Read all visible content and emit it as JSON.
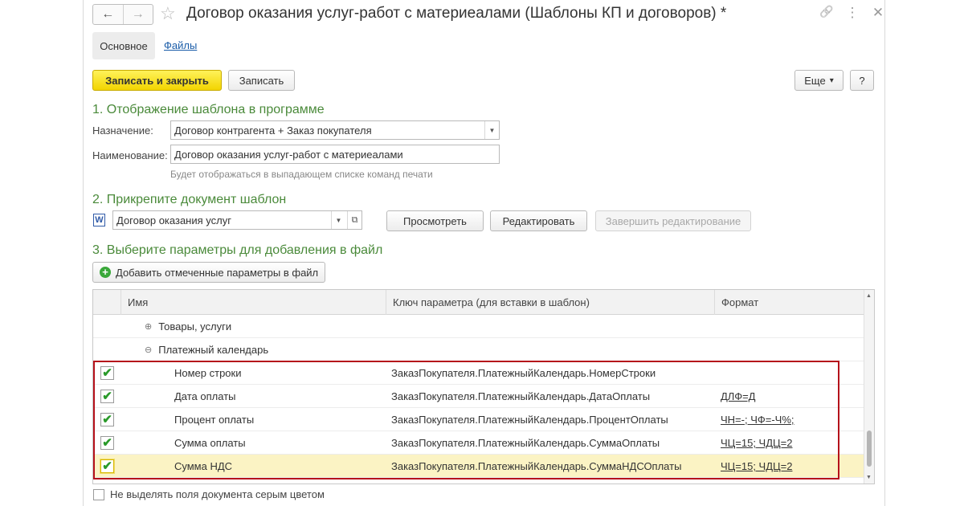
{
  "window": {
    "title": "Договор оказания услуг-работ с материеалами (Шаблоны КП и договоров) *",
    "back_icon": "←",
    "forward_icon": "→",
    "star_icon": "☆",
    "link_icon": "🔗",
    "more_icon": "⋮",
    "close_icon": "✕"
  },
  "tabs": {
    "main": "Основное",
    "files": "Файлы"
  },
  "toolbar": {
    "save_close": "Записать и закрыть",
    "save": "Записать",
    "more": "Еще",
    "more_arrow": "▾",
    "help": "?"
  },
  "section1": {
    "title": "1. Отображение шаблона в программе",
    "purpose_label": "Назначение:",
    "purpose_value": "Договор контрагента + Заказ покупателя",
    "name_label": "Наименование:",
    "name_value": "Договор оказания услуг-работ с материеалами",
    "hint": "Будет отображаться в выпадающем списке команд печати"
  },
  "section2": {
    "title": "2. Прикрепите документ шаблон",
    "word_icon": "W",
    "template_value": "Договор оказания услуг",
    "open_icon": "⧉",
    "view_btn": "Просмотреть",
    "edit_btn": "Редактировать",
    "finish_btn": "Завершить редактирование"
  },
  "section3": {
    "title": "3. Выберите параметры для добавления в файл",
    "add_btn": "Добавить отмеченные параметры в файл",
    "add_icon": "+"
  },
  "table": {
    "columns": [
      "Имя",
      "Ключ параметра (для вставки в шаблон)",
      "Формат"
    ],
    "groups": [
      {
        "expander": "⊕",
        "name": "Товары, услуги"
      },
      {
        "expander": "⊖",
        "name": "Платежный календарь"
      }
    ],
    "rows": [
      {
        "checked": "✔",
        "name": "Номер строки",
        "key": "ЗаказПокупателя.ПлатежныйКалендарь.НомерСтроки",
        "format": ""
      },
      {
        "checked": "✔",
        "name": "Дата оплаты",
        "key": "ЗаказПокупателя.ПлатежныйКалендарь.ДатаОплаты",
        "format": "ДЛФ=Д"
      },
      {
        "checked": "✔",
        "name": "Процент оплаты",
        "key": "ЗаказПокупателя.ПлатежныйКалендарь.ПроцентОплаты",
        "format": "ЧН=-; ЧФ=-Ч%;"
      },
      {
        "checked": "✔",
        "name": "Сумма оплаты",
        "key": "ЗаказПокупателя.ПлатежныйКалендарь.СуммаОплаты",
        "format": "ЧЦ=15; ЧДЦ=2"
      },
      {
        "checked": "✔",
        "name": "Сумма НДС",
        "key": "ЗаказПокупателя.ПлатежныйКалендарь.СуммаНДСОплаты",
        "format": "ЧЦ=15; ЧДЦ=2"
      }
    ],
    "scroll_up": "▲",
    "scroll_down": "▼"
  },
  "footer": {
    "gray_fields_label": "Не выделять поля документа серым цветом"
  },
  "colors": {
    "accent_green": "#4a8a3a",
    "primary_yellow": "#f2d400",
    "highlight_red": "#b5121b",
    "selected_row": "#fbf3c4"
  }
}
